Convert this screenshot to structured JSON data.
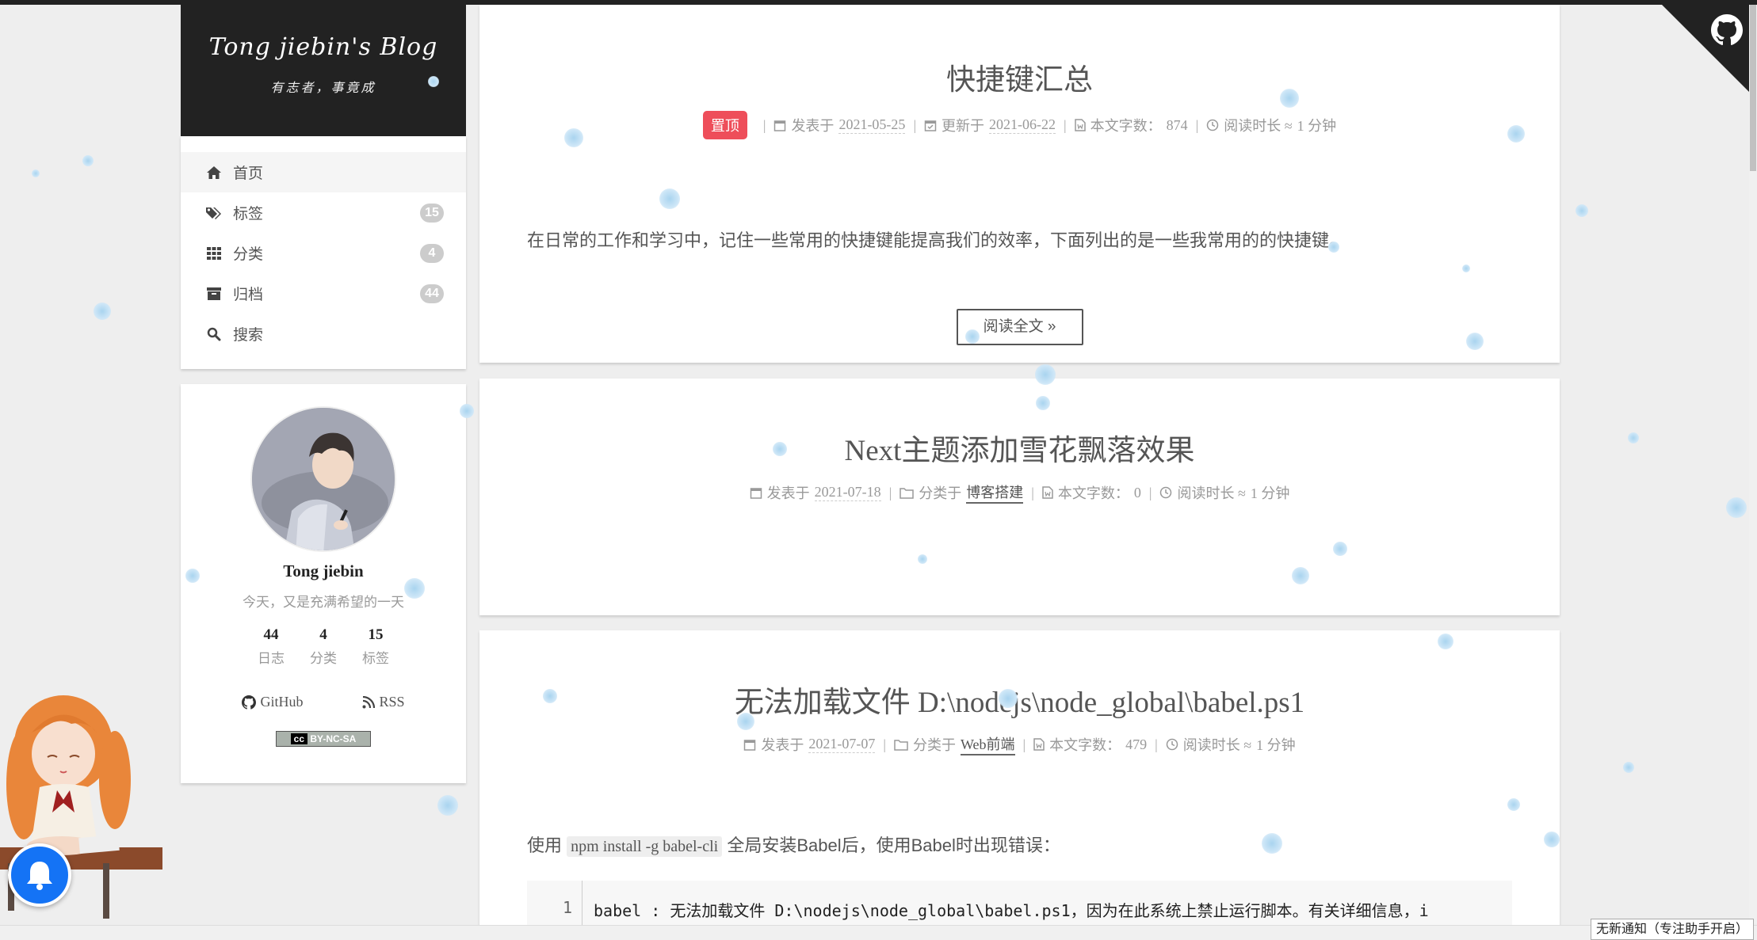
{
  "site": {
    "title": "Tong jiebin's Blog",
    "subtitle": "有志者，事竟成"
  },
  "menu": {
    "items": [
      {
        "label": "首页",
        "icon": "home-icon"
      },
      {
        "label": "标签",
        "icon": "tags-icon",
        "count": "15"
      },
      {
        "label": "分类",
        "icon": "th-icon",
        "count": "4"
      },
      {
        "label": "归档",
        "icon": "archive-icon",
        "count": "44"
      },
      {
        "label": "搜索",
        "icon": "search-icon"
      }
    ]
  },
  "profile": {
    "name": "Tong jiebin",
    "motto": "今天，又是充满希望的一天",
    "stats": [
      {
        "count": "44",
        "label": "日志"
      },
      {
        "count": "4",
        "label": "分类"
      },
      {
        "count": "15",
        "label": "标签"
      }
    ],
    "links": [
      {
        "label": "GitHub",
        "icon": "github-icon"
      },
      {
        "label": "RSS",
        "icon": "rss-icon"
      }
    ],
    "license": "BY-NC-SA",
    "license_badge": "cc"
  },
  "posts": [
    {
      "title": "快捷键汇总",
      "sticky": "置顶",
      "posted_label": "发表于",
      "posted": "2021-05-25",
      "updated_label": "更新于",
      "updated": "2021-06-22",
      "words_label": "本文字数：",
      "words": "874",
      "reading_label": "阅读时长 ≈",
      "reading": "1 分钟",
      "excerpt": "在日常的工作和学习中，记住一些常用的快捷键能提高我们的效率，下面列出的是一些我常用的的快捷键。",
      "read_more": "阅读全文 »"
    },
    {
      "title": "Next主题添加雪花飘落效果",
      "posted_label": "发表于",
      "posted": "2021-07-18",
      "category_label": "分类于",
      "category": "博客搭建",
      "words_label": "本文字数：",
      "words": "0",
      "reading_label": "阅读时长 ≈",
      "reading": "1 分钟"
    },
    {
      "title": "无法加载文件 D:\\nodejs\\node_global\\babel.ps1",
      "posted_label": "发表于",
      "posted": "2021-07-07",
      "category_label": "分类于",
      "category": "Web前端",
      "words_label": "本文字数：",
      "words": "479",
      "reading_label": "阅读时长 ≈",
      "reading": "1 分钟",
      "body_prefix": "使用",
      "body_code": "npm install -g babel-cli",
      "body_suffix": "全局安装Babel后，使用Babel时出现错误：",
      "code_line_no": "1",
      "code_line": "babel : 无法加载文件 D:\\nodejs\\node_global\\babel.ps1，因为在此系统上禁止运行脚本。有关详细信息，i"
    }
  ],
  "notification": "无新通知（专注助手开启）",
  "colors": {
    "brand_bg": "#222222",
    "sticky_badge": "#ee4e5a",
    "bell": "#1473f5",
    "page_bg": "#eeeeee"
  }
}
